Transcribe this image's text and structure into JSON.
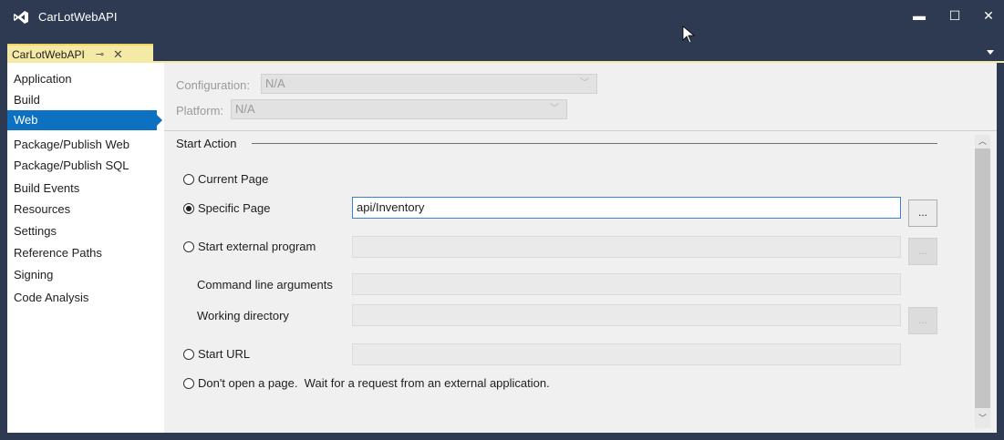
{
  "app": {
    "title": "CarLotWebAPI"
  },
  "window_controls": {
    "minimize": "▬",
    "maximize": "☐",
    "close": "✕"
  },
  "tab": {
    "label": "CarLotWebAPI",
    "pin_icon": "pin-icon",
    "close_icon": "close-icon"
  },
  "sidebar": {
    "items": [
      {
        "label": "Application",
        "selected": false
      },
      {
        "label": "Build",
        "selected": false
      },
      {
        "label": "Web",
        "selected": true
      },
      {
        "label": "Package/Publish Web",
        "selected": false
      },
      {
        "label": "Package/Publish SQL",
        "selected": false
      },
      {
        "label": "Build Events",
        "selected": false
      },
      {
        "label": "Resources",
        "selected": false
      },
      {
        "label": "Settings",
        "selected": false
      },
      {
        "label": "Reference Paths",
        "selected": false
      },
      {
        "label": "Signing",
        "selected": false
      },
      {
        "label": "Code Analysis",
        "selected": false
      }
    ]
  },
  "config": {
    "configuration_label": "Configuration:",
    "configuration_value": "N/A",
    "platform_label": "Platform:",
    "platform_value": "N/A"
  },
  "start_action": {
    "title": "Start Action",
    "current_page": "Current Page",
    "specific_page": "Specific Page",
    "specific_page_value": "api/Inventory",
    "external_program": "Start external program",
    "command_line_args": "Command line arguments",
    "working_directory": "Working directory",
    "start_url": "Start URL",
    "dont_open": "Don't open a page.  Wait for a request from an external application.",
    "selected": "specific_page",
    "browse_label": "..."
  },
  "colors": {
    "titlebar": "#2d3a52",
    "tab_active": "#f5e9a6",
    "selection": "#0e70c0",
    "content_bg": "#f0f0f0"
  }
}
